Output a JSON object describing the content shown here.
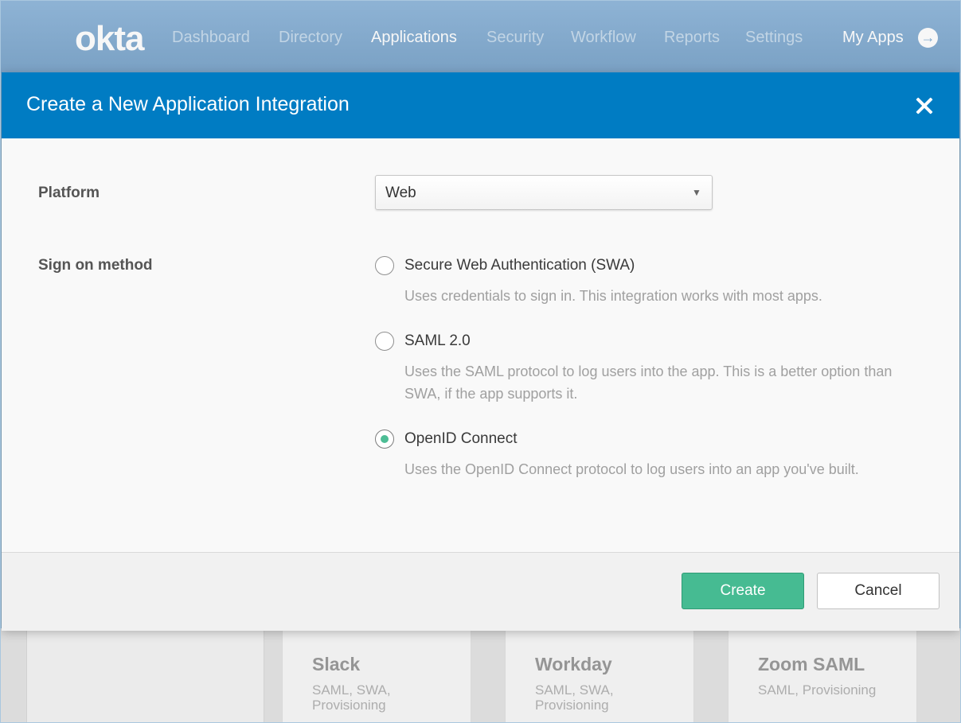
{
  "topbar": {
    "logo": "okta",
    "nav": [
      "Dashboard",
      "Directory",
      "Applications",
      "Security",
      "Workflow",
      "Reports",
      "Settings"
    ],
    "active_nav": "Applications",
    "my_apps": "My Apps",
    "my_apps_icon": "arrow-right-circle-icon"
  },
  "modal": {
    "title": "Create a New Application Integration",
    "close_icon": "close-icon",
    "platform_label": "Platform",
    "platform_value": "Web",
    "sign_on_label": "Sign on method",
    "options": [
      {
        "label": "Secure Web Authentication (SWA)",
        "description": "Uses credentials to sign in. This integration works with most apps.",
        "selected": false
      },
      {
        "label": "SAML 2.0",
        "description": "Uses the SAML protocol to log users into the app. This is a better option than SWA, if the app supports it.",
        "selected": false
      },
      {
        "label": "OpenID Connect",
        "description": "Uses the OpenID Connect protocol to log users into an app you've built.",
        "selected": true
      }
    ],
    "create_label": "Create",
    "cancel_label": "Cancel"
  },
  "catalog": {
    "apps": [
      {
        "name": "Slack",
        "protocols": "SAML, SWA, Provisioning"
      },
      {
        "name": "Workday",
        "protocols": "SAML, SWA, Provisioning"
      },
      {
        "name": "Zoom SAML",
        "protocols": "SAML, Provisioning"
      }
    ]
  },
  "colors": {
    "header_blue": "#007cc3",
    "nav_bar": "#8eb3cf",
    "create_green": "#46bb92",
    "radio_selected": "#4dbd95"
  }
}
